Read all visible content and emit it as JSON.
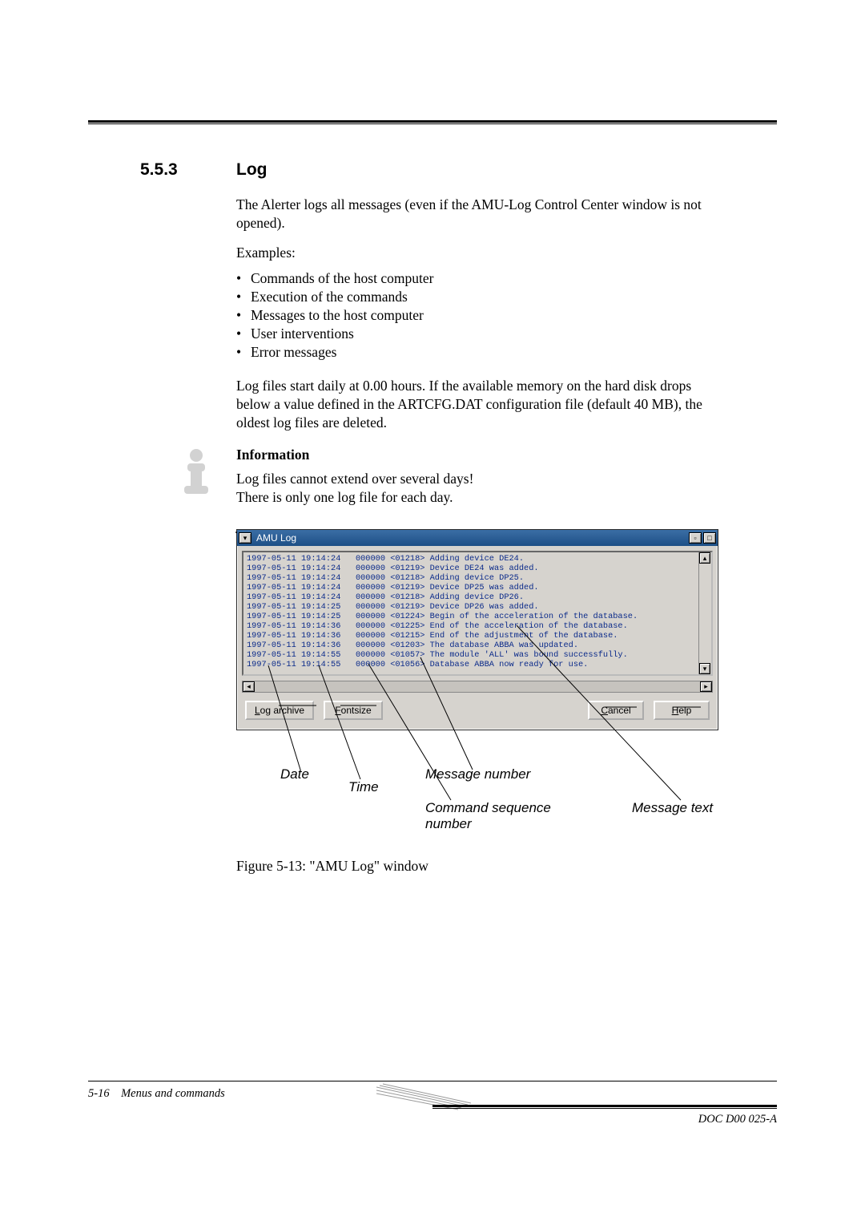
{
  "section_number": "5.5.3",
  "section_title": "Log",
  "para1": "The Alerter logs all messages (even if the AMU-Log Control Center window is not opened).",
  "para2": "Examples:",
  "bullets": {
    "b1": "Commands of the host computer",
    "b2": "Execution of the commands",
    "b3": "Messages to the host computer",
    "b4": "User interventions",
    "b5": "Error messages"
  },
  "para3": "Log files start daily at 0.00 hours. If the available memory on the hard disk drops below a value defined in the ARTCFG.DAT configuration file (default 40 MB), the oldest log files are deleted.",
  "info_heading": "Information",
  "para4_line1": "Log files cannot extend over several days!",
  "para4_line2": "There is only one log file for each day.",
  "window": {
    "title": "AMU Log",
    "log_lines": "1997-05-11 19:14:24   000000 <01218> Adding device DE24.\n1997-05-11 19:14:24   000000 <01219> Device DE24 was added.\n1997-05-11 19:14:24   000000 <01218> Adding device DP25.\n1997-05-11 19:14:24   000000 <01219> Device DP25 was added.\n1997-05-11 19:14:24   000000 <01218> Adding device DP26.\n1997-05-11 19:14:25   000000 <01219> Device DP26 was added.\n1997-05-11 19:14:25   000000 <01224> Begin of the acceleration of the database.\n1997-05-11 19:14:36   000000 <01225> End of the acceleration of the database.\n1997-05-11 19:14:36   000000 <01215> End of the adjustment of the database.\n1997-05-11 19:14:36   000000 <01203> The database ABBA was updated.\n1997-05-11 19:14:55   000000 <01057> The module 'ALL' was bound successfully.\n1997-05-11 19:14:55   000000 <01056> Database ABBA now ready for use.",
    "buttons": {
      "log_archive": "Log archive",
      "fontsize": "Fontsize",
      "cancel": "Cancel",
      "help": "Help"
    }
  },
  "callouts": {
    "date": "Date",
    "time": "Time",
    "msg_num": "Message number",
    "cmd_seq_l1": "Command sequence",
    "cmd_seq_l2": "number",
    "msg_text": "Message text"
  },
  "figure_caption": "Figure 5-13: \"AMU Log\" window",
  "footer": {
    "left_page": "5-16",
    "left_text": "Menus and commands",
    "right_text": "DOC D00 025-A"
  }
}
